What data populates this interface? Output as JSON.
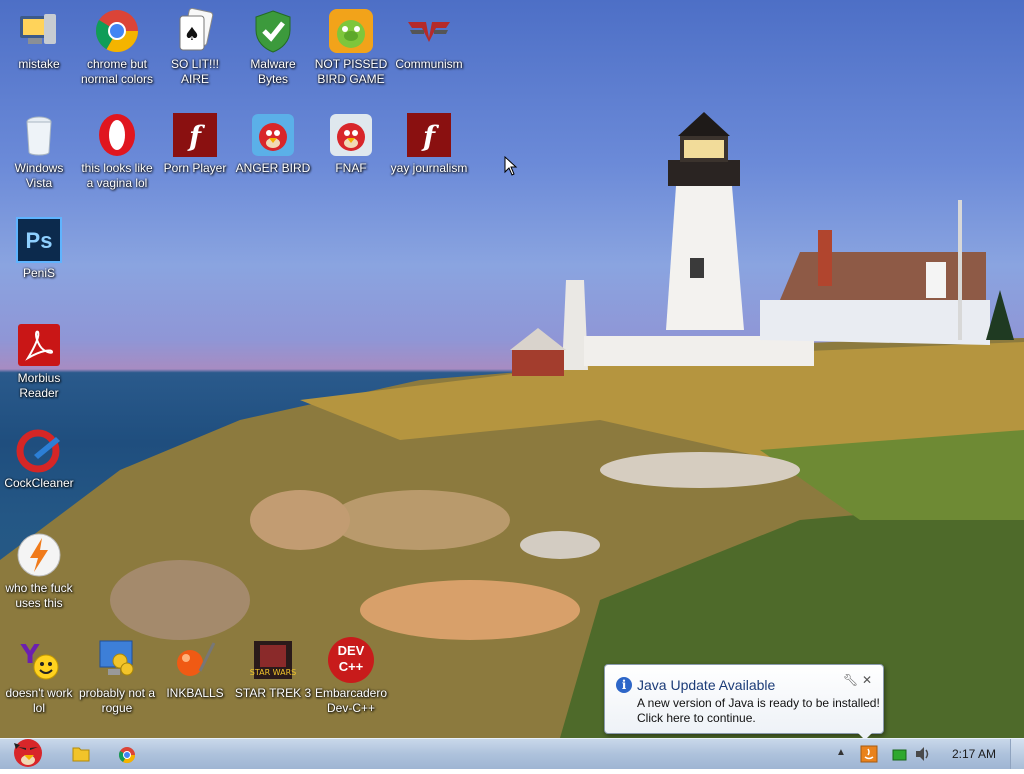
{
  "desktop": {
    "icons": [
      {
        "label": "mistake",
        "icon": "computer-icon"
      },
      {
        "label": "chrome but normal colors",
        "icon": "chrome-icon"
      },
      {
        "label": "SO LIT!!! AIRE",
        "icon": "solitaire-icon"
      },
      {
        "label": "Malware Bytes",
        "icon": "shield-check-icon"
      },
      {
        "label": "NOT PISSED BIRD GAME",
        "icon": "green-pig-icon"
      },
      {
        "label": "Communism",
        "icon": "winged-emblem-icon"
      },
      {
        "label": "Windows Vista",
        "icon": "trash-bin-icon"
      },
      {
        "label": "this looks like a vagina lol",
        "icon": "opera-icon"
      },
      {
        "label": "Porn Player",
        "icon": "flash-icon"
      },
      {
        "label": "ANGER BIRD",
        "icon": "red-bird-icon"
      },
      {
        "label": "FNAF",
        "icon": "red-bird-icon"
      },
      {
        "label": "yay journalism",
        "icon": "flash-icon"
      },
      {
        "label": "PeniS",
        "icon": "photoshop-icon"
      },
      {
        "label": "Morbius Reader",
        "icon": "pdf-icon"
      },
      {
        "label": "CockCleaner",
        "icon": "ccleaner-icon"
      },
      {
        "label": "who the fuck uses this",
        "icon": "lightning-icon"
      },
      {
        "label": "doesn't work lol",
        "icon": "yahoo-messenger-icon"
      },
      {
        "label": "probably not a rogue",
        "icon": "gears-monitor-icon"
      },
      {
        "label": "INKBALLS",
        "icon": "inkball-icon"
      },
      {
        "label": "STAR TREK 3",
        "icon": "star-wars-icon"
      },
      {
        "label": "Embarcadero Dev-C++",
        "icon": "dev-cpp-icon"
      }
    ],
    "dev_text_1": "DEV",
    "dev_text_2": "C++",
    "ps_text": "Ps"
  },
  "taskbar": {
    "clock": "2:17 AM",
    "pinned": [
      "angry-bird-start-icon",
      "folder-icon",
      "chrome-icon"
    ]
  },
  "notification": {
    "title": "Java Update Available",
    "message_line1": "A new version of Java is ready to be installed!",
    "message_line2": "Click here to continue.",
    "info_glyph": "i"
  },
  "colors": {
    "label_text": "#ffffff",
    "taskbar": "#aec2dc",
    "balloon_title": "#1c3c78"
  }
}
